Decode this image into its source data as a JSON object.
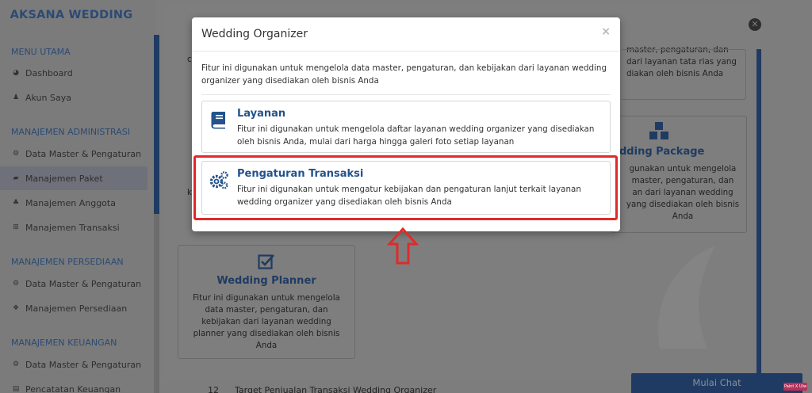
{
  "sidebar": {
    "brand": "AKSANA WEDDING",
    "sections": [
      {
        "title": "MENU UTAMA",
        "items": [
          {
            "label": "Dashboard",
            "icon": "dashboard-icon",
            "active": false
          },
          {
            "label": "Akun Saya",
            "icon": "user-icon",
            "active": false
          }
        ]
      },
      {
        "title": "MANAJEMEN ADMINISTRASI",
        "items": [
          {
            "label": "Data Master & Pengaturan",
            "icon": "cogs-icon",
            "active": false
          },
          {
            "label": "Manajemen Paket",
            "icon": "book-icon",
            "active": true
          },
          {
            "label": "Manajemen Anggota",
            "icon": "users-icon",
            "active": false
          },
          {
            "label": "Manajemen Transaksi",
            "icon": "cart-icon",
            "active": false
          }
        ]
      },
      {
        "title": "MANAJEMEN PERSEDIAAN",
        "items": [
          {
            "label": "Data Master & Pengaturan",
            "icon": "cogs-icon",
            "active": false
          },
          {
            "label": "Manajemen Persediaan",
            "icon": "cubes-icon",
            "active": false
          }
        ]
      },
      {
        "title": "MANAJEMEN KEUANGAN",
        "items": [
          {
            "label": "Data Master & Pengaturan",
            "icon": "cogs-icon",
            "active": false
          },
          {
            "label": "Pencatatan Keuangan",
            "icon": "ledger-icon",
            "active": false
          }
        ]
      }
    ]
  },
  "background": {
    "top_right_text": [
      "master, pengaturan, dan",
      "dari layanan tata rias yang",
      "diakan oleh bisnis Anda"
    ],
    "package_card": {
      "title": "dding Package",
      "desc": [
        "gunakan untuk mengelola",
        "master, pengaturan, dan",
        "an dari layanan wedding",
        "yang disediakan oleh bisnis",
        "Anda"
      ]
    },
    "planner_card": {
      "title": "Wedding Planner",
      "desc": [
        "Fitur ini digunakan untuk mengelola",
        "data master, pengaturan, dan",
        "kebijakan dari layanan wedding",
        "planner yang disediakan oleh bisnis",
        "Anda"
      ]
    },
    "left_edge_letters": [
      "c",
      "k"
    ],
    "bottom_row_number": "12",
    "bottom_row_text": "Target Penjualan Transaksi Wedding Organizer",
    "chat_button": "Mulai Chat",
    "ext_tag": "Paint X Ulw"
  },
  "modal": {
    "title": "Wedding Organizer",
    "close": "×",
    "intro": "Fitur ini digunakan untuk mengelola data master, pengaturan, dan kebijakan dari layanan wedding organizer yang disediakan oleh bisnis Anda",
    "options": [
      {
        "title": "Layanan",
        "icon": "book-icon",
        "desc": "Fitur ini digunakan untuk mengelola daftar layanan wedding organizer yang disediakan oleh bisnis Anda, mulai dari harga hingga galeri foto setiap layanan"
      },
      {
        "title": "Pengaturan Transaksi",
        "icon": "cogs-icon",
        "desc": "Fitur ini digunakan untuk mengatur kebijakan dan pengaturan lanjut terkait layanan wedding organizer yang disediakan oleh bisnis Anda"
      }
    ]
  },
  "annotation": {
    "highlight_color": "#e02a2a",
    "target": "Pengaturan Transaksi"
  }
}
